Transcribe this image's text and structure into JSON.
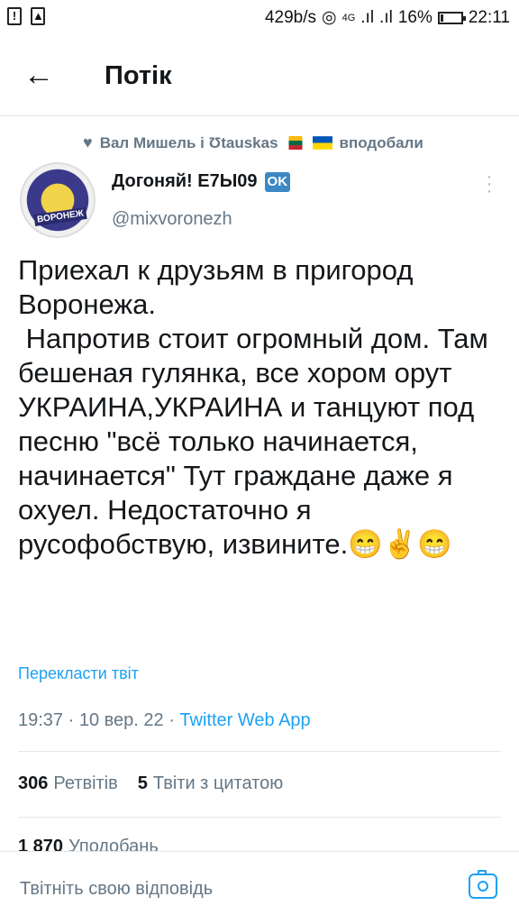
{
  "status_bar": {
    "net_speed": "429b/s",
    "signal": "4G",
    "battery": "16%",
    "time": "22:11",
    "battery_level": 0.16
  },
  "header": {
    "title": "Потік"
  },
  "social_context": {
    "text_before": "Вал Мишель і Ʊtauskas",
    "text_after": "вподобали"
  },
  "author": {
    "name": "Догоняй! Е7Ы09",
    "badge": "OK",
    "handle": "@mixvoronezh",
    "avatar_text": "ВОРОНЕЖ"
  },
  "tweet": {
    "text": "Приехал к друзьям в пригород Воронежа.\n Напротив стоит огромный дом. Там бешеная гулянка, все хором орут УКРАИНА,УКРАИНА и танцуют под песню \"всё только начинается, начинается\" Тут граждане даже я охуел. Недостаточно я русофобствую, извините.😁✌😁",
    "translate_label": "Перекласти твіт",
    "timestamp": "19:37 · 10 вер. 22 · ",
    "source": "Twitter Web App"
  },
  "stats": {
    "retweets_count": "306",
    "retweets_label": "Ретвітів",
    "quotes_count": "5",
    "quotes_label": "Твіти з цитатою",
    "likes_count": "1 870",
    "likes_label": "Уподобань"
  },
  "reply": {
    "placeholder": "Твітніть свою відповідь"
  }
}
